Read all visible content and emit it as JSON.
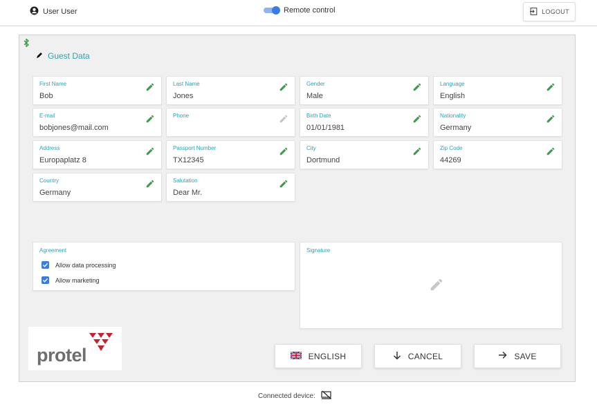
{
  "header": {
    "user_name": "User User",
    "remote_label": "Remote control",
    "remote_on": true,
    "logout_label": "LOGOUT"
  },
  "section": {
    "title": "Guest Data"
  },
  "fields": [
    {
      "label": "First Name",
      "value": "Bob",
      "editable": true
    },
    {
      "label": "Last Name",
      "value": "Jones",
      "editable": true
    },
    {
      "label": "Gender",
      "value": "Male",
      "editable": true
    },
    {
      "label": "Language",
      "value": "English",
      "editable": true
    },
    {
      "label": "E-mail",
      "value": "bobjones@mail.com",
      "editable": true
    },
    {
      "label": "Phone",
      "value": "",
      "editable": false
    },
    {
      "label": "Birth Date",
      "value": "01/01/1981",
      "editable": true
    },
    {
      "label": "Nationality",
      "value": "Germany",
      "editable": true
    },
    {
      "label": "Address",
      "value": "Europaplatz 8",
      "editable": true
    },
    {
      "label": "Passport Number",
      "value": "TX12345",
      "editable": true
    },
    {
      "label": "City",
      "value": "Dortmund",
      "editable": true
    },
    {
      "label": "Zip Code",
      "value": "44269",
      "editable": true
    },
    {
      "label": "Country",
      "value": "Germany",
      "editable": true
    },
    {
      "label": "Salutation",
      "value": "Dear Mr.",
      "editable": true
    }
  ],
  "agreement": {
    "title": "Agreement",
    "items": [
      {
        "label": "Allow data processing",
        "checked": true
      },
      {
        "label": "Allow marketing",
        "checked": true
      }
    ]
  },
  "signature": {
    "title": "Signature"
  },
  "logo": {
    "text": "protel"
  },
  "buttons": {
    "language_label": "ENGLISH",
    "cancel_label": "CANCEL",
    "save_label": "SAVE"
  },
  "footer": {
    "connected_label": "Connected device:"
  },
  "colors": {
    "accent": "#2ba3b3",
    "edit_green": "#3d9a47",
    "toggle_blue": "#3b7be4",
    "brand_red": "#c8202f"
  }
}
